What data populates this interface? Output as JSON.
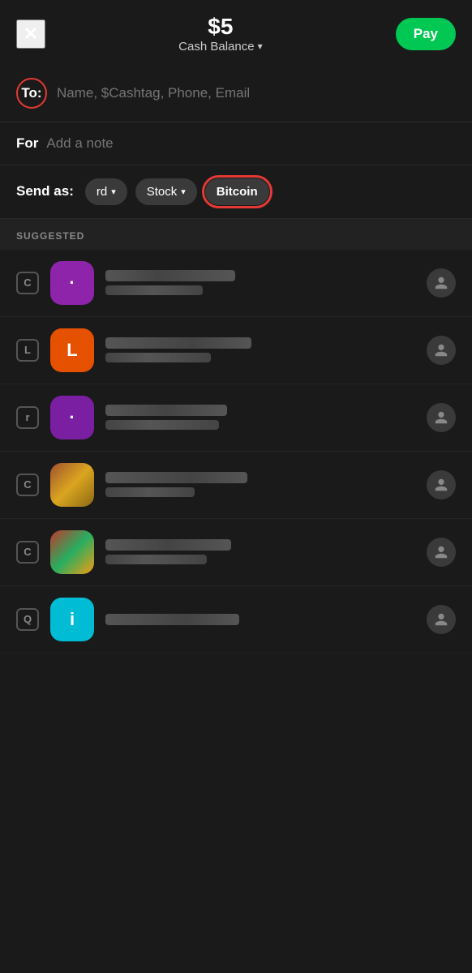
{
  "header": {
    "close_label": "✕",
    "amount": "$5",
    "balance_label": "Cash Balance",
    "balance_chevron": "▾",
    "pay_label": "Pay"
  },
  "to_section": {
    "label": "To:",
    "placeholder": "Name, $Cashtag, Phone, Email"
  },
  "for_section": {
    "label": "For",
    "placeholder": "Add a note"
  },
  "send_as": {
    "label": "Send as:",
    "card_label": "rd",
    "card_chevron": "▾",
    "stock_label": "Stock",
    "stock_chevron": "▾",
    "bitcoin_label": "Bitcoin"
  },
  "suggested": {
    "header": "SUGGESTED"
  },
  "contacts": [
    {
      "id": 1,
      "letter": "C",
      "avatar_color": "purple",
      "initial": "·"
    },
    {
      "id": 2,
      "letter": "L",
      "avatar_color": "orange",
      "initial": "L"
    },
    {
      "id": 3,
      "letter": "r",
      "avatar_color": "purple2",
      "initial": "·"
    },
    {
      "id": 4,
      "letter": "C",
      "avatar_color": "brown",
      "initial": ""
    },
    {
      "id": 5,
      "letter": "C",
      "avatar_color": "multicolor",
      "initial": ""
    },
    {
      "id": 6,
      "letter": "Q",
      "avatar_color": "cyan",
      "initial": "i"
    }
  ]
}
